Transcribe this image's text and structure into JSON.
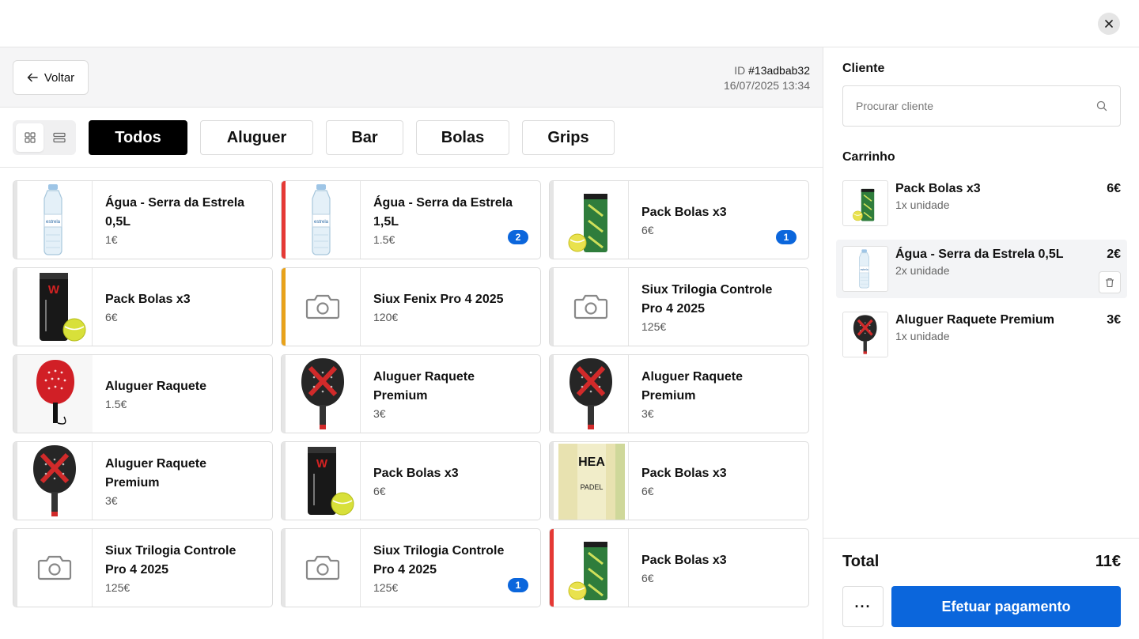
{
  "header": {
    "back_label": "Voltar",
    "id_prefix": "ID",
    "order_id": "#13adbab32",
    "datetime": "16/07/2025 13:34"
  },
  "categories": [
    {
      "label": "Todos",
      "active": true
    },
    {
      "label": "Aluguer",
      "active": false
    },
    {
      "label": "Bar",
      "active": false
    },
    {
      "label": "Bolas",
      "active": false
    },
    {
      "label": "Grips",
      "active": false
    }
  ],
  "products": [
    {
      "name": "Água - Serra da Estrela 0,5L",
      "price": "1€",
      "image": "water-bottle-small",
      "stripe": "#e5e5e5",
      "badge": ""
    },
    {
      "name": "Água - Serra da Estrela 1,5L",
      "price": "1.5€",
      "image": "water-bottle-large",
      "stripe": "#e53935",
      "badge": "2"
    },
    {
      "name": "Pack Bolas x3",
      "price": "6€",
      "image": "ball-tube-green",
      "stripe": "#e5e5e5",
      "badge": "1"
    },
    {
      "name": "Pack Bolas x3",
      "price": "6€",
      "image": "ball-tube-black",
      "stripe": "#e5e5e5",
      "badge": ""
    },
    {
      "name": "Siux Fenix Pro 4 2025",
      "price": "120€",
      "image": "camera-placeholder",
      "stripe": "#e8a21a",
      "badge": ""
    },
    {
      "name": "Siux Trilogia Controle Pro 4 2025",
      "price": "125€",
      "image": "camera-placeholder",
      "stripe": "#e5e5e5",
      "badge": ""
    },
    {
      "name": "Aluguer Raquete",
      "price": "1.5€",
      "image": "racket-red",
      "stripe": "#e5e5e5",
      "badge": ""
    },
    {
      "name": "Aluguer Raquete Premium",
      "price": "3€",
      "image": "racket-black",
      "stripe": "#e5e5e5",
      "badge": ""
    },
    {
      "name": "Aluguer Raquete Premium",
      "price": "3€",
      "image": "racket-black",
      "stripe": "#e5e5e5",
      "badge": ""
    },
    {
      "name": "Aluguer Raquete Premium",
      "price": "3€",
      "image": "racket-black",
      "stripe": "#e5e5e5",
      "badge": ""
    },
    {
      "name": "Pack Bolas x3",
      "price": "6€",
      "image": "ball-tube-black",
      "stripe": "#e5e5e5",
      "badge": ""
    },
    {
      "name": "Pack Bolas x3",
      "price": "6€",
      "image": "ball-box-head",
      "stripe": "#e5e5e5",
      "badge": ""
    },
    {
      "name": "Siux Trilogia Controle Pro 4 2025",
      "price": "125€",
      "image": "camera-placeholder",
      "stripe": "#e5e5e5",
      "badge": ""
    },
    {
      "name": "Siux Trilogia Controle Pro 4 2025",
      "price": "125€",
      "image": "camera-placeholder",
      "stripe": "#e5e5e5",
      "badge": "1"
    },
    {
      "name": "Pack Bolas x3",
      "price": "6€",
      "image": "ball-tube-green",
      "stripe": "#e53935",
      "badge": ""
    }
  ],
  "sidebar": {
    "client_title": "Cliente",
    "client_placeholder": "Procurar cliente",
    "cart_title": "Carrinho",
    "cart_items": [
      {
        "name": "Pack Bolas x3",
        "qty": "1x unidade",
        "price": "6€",
        "image": "ball-tube-green",
        "highlighted": false
      },
      {
        "name": "Água - Serra da Estrela 0,5L",
        "qty": "2x unidade",
        "price": "2€",
        "image": "water-bottle-small",
        "highlighted": true
      },
      {
        "name": "Aluguer Raquete Premium",
        "qty": "1x unidade",
        "price": "3€",
        "image": "racket-black",
        "highlighted": false
      }
    ],
    "total_label": "Total",
    "total_value": "11€",
    "more_label": "···",
    "pay_label": "Efetuar pagamento"
  },
  "colors": {
    "accent": "#0b66dc",
    "stripe_red": "#e53935",
    "stripe_orange": "#e8a21a"
  }
}
